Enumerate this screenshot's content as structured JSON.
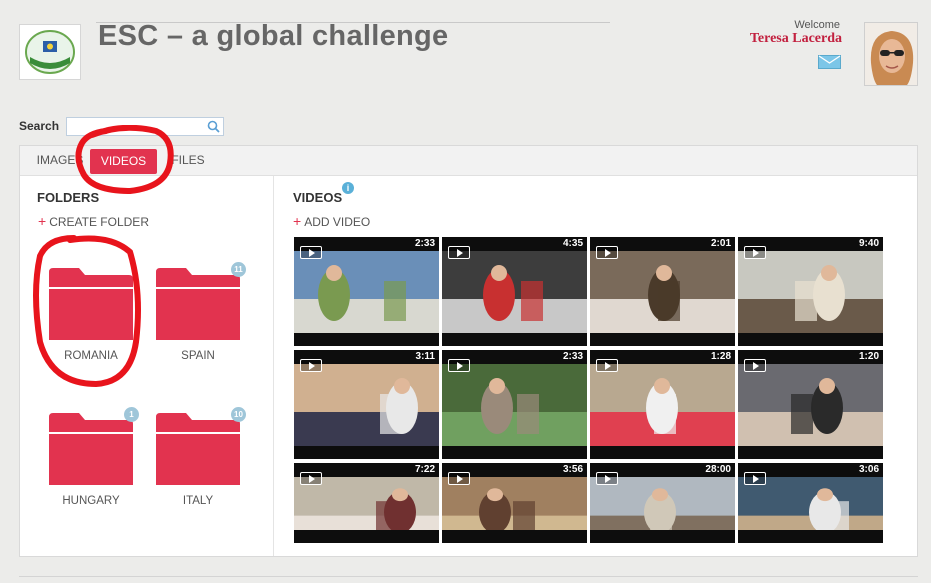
{
  "header": {
    "title": "ESC – a global challenge",
    "welcome": "Welcome",
    "user_name": "Teresa Lacerda"
  },
  "search": {
    "label": "Search",
    "placeholder": ""
  },
  "tabs": [
    {
      "label": "IMAGES",
      "active": false
    },
    {
      "label": "VIDEOS",
      "active": true
    },
    {
      "label": "FILES",
      "active": false
    }
  ],
  "folders_panel": {
    "title": "FOLDERS",
    "create_label": "CREATE FOLDER",
    "folders": [
      {
        "label": "ROMANIA",
        "badge": ""
      },
      {
        "label": "SPAIN",
        "badge": "11"
      },
      {
        "label": "HUNGARY",
        "badge": "1"
      },
      {
        "label": "ITALY",
        "badge": "10"
      }
    ]
  },
  "videos_panel": {
    "title": "VIDEOS",
    "add_label": "ADD VIDEO",
    "videos": [
      {
        "duration": "2:33"
      },
      {
        "duration": "4:35"
      },
      {
        "duration": "2:01"
      },
      {
        "duration": "9:40"
      },
      {
        "duration": "3:11"
      },
      {
        "duration": "2:33"
      },
      {
        "duration": "1:28"
      },
      {
        "duration": "1:20"
      },
      {
        "duration": "7:22"
      },
      {
        "duration": "3:56"
      },
      {
        "duration": "28:00"
      },
      {
        "duration": "3:06"
      }
    ]
  },
  "colors": {
    "accent": "#e2334f",
    "annotation": "#e8141c"
  }
}
